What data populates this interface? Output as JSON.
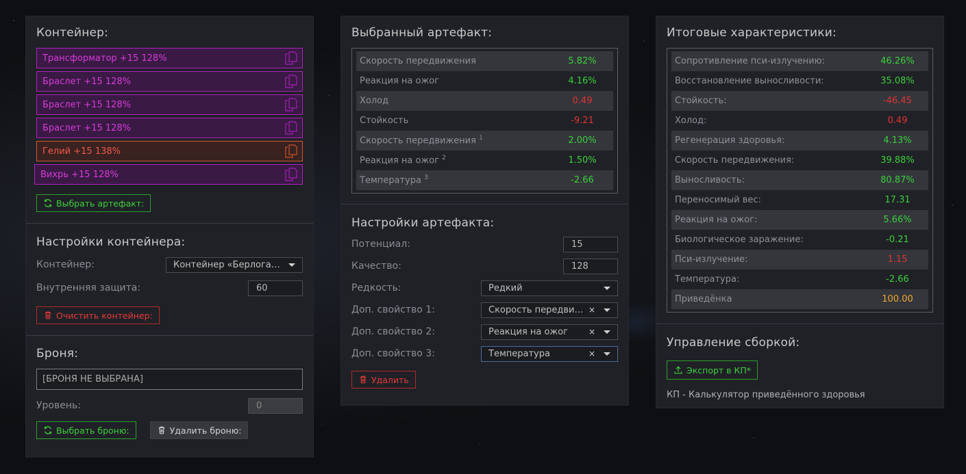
{
  "container": {
    "title": "Контейнер:",
    "items": [
      {
        "label": "Трансформатор +15 128%",
        "color": "purple"
      },
      {
        "label": "Браслет +15 128%",
        "color": "purple"
      },
      {
        "label": "Браслет +15 128%",
        "color": "purple"
      },
      {
        "label": "Браслет +15 128%",
        "color": "purple"
      },
      {
        "label": "Гелий +15 138%",
        "color": "orange"
      },
      {
        "label": "Вихрь +15 128%",
        "color": "purple"
      }
    ],
    "select_artifact_label": "Выбрать артефакт:"
  },
  "container_settings": {
    "title": "Настройки контейнера:",
    "container_label": "Контейнер:",
    "container_value": "Контейнер «Берлога…",
    "inner_protection_label": "Внутренняя защита:",
    "inner_protection_value": "60",
    "clear_label": "Очистить контейнер:"
  },
  "armor": {
    "title": "Броня:",
    "value": "[БРОНЯ НЕ ВЫБРАНА]",
    "level_label": "Уровень:",
    "level_value": "0",
    "select_label": "Выбрать броню:",
    "delete_label": "Удалить броню:"
  },
  "selected_artifact": {
    "title": "Выбранный артефакт:",
    "stats": [
      {
        "name": "Скорость передвижения",
        "sup": "",
        "value": "5.82%",
        "tone": "green"
      },
      {
        "name": "Реакция на ожог",
        "sup": "",
        "value": "4.16%",
        "tone": "green"
      },
      {
        "name": "Холод",
        "sup": "",
        "value": "0.49",
        "tone": "red"
      },
      {
        "name": "Стойкость",
        "sup": "",
        "value": "-9.21",
        "tone": "red"
      },
      {
        "name": "Скорость передвижения",
        "sup": "1",
        "value": "2.00%",
        "tone": "green"
      },
      {
        "name": "Реакция на ожог",
        "sup": "2",
        "value": "1.50%",
        "tone": "green"
      },
      {
        "name": "Температура",
        "sup": "3",
        "value": "-2.66",
        "tone": "green"
      }
    ]
  },
  "artifact_settings": {
    "title": "Настройки артефакта:",
    "potential_label": "Потенциал:",
    "potential_value": "15",
    "quality_label": "Качество:",
    "quality_value": "128",
    "rarity_label": "Редкость:",
    "rarity_value": "Редкий",
    "extra1_label": "Доп. свойство 1:",
    "extra1_value": "Скорость передвижения",
    "extra2_label": "Доп. свойство 2:",
    "extra2_value": "Реакция на ожог",
    "extra3_label": "Доп. свойство 3:",
    "extra3_value": "Температура",
    "clear_symbol": "×",
    "delete_label": "Удалить"
  },
  "totals": {
    "title": "Итоговые характеристики:",
    "stats": [
      {
        "name": "Сопротивление пси-излучению:",
        "value": "46.26%",
        "tone": "green"
      },
      {
        "name": "Восстановление выносливости:",
        "value": "35.08%",
        "tone": "green"
      },
      {
        "name": "Стойкость:",
        "value": "-46.45",
        "tone": "red"
      },
      {
        "name": "Холод:",
        "value": "0.49",
        "tone": "red"
      },
      {
        "name": "Регенерация здоровья:",
        "value": "4.13%",
        "tone": "green"
      },
      {
        "name": "Скорость передвижения:",
        "value": "39.88%",
        "tone": "green"
      },
      {
        "name": "Выносливость:",
        "value": "80.87%",
        "tone": "green"
      },
      {
        "name": "Переносимый вес:",
        "value": "17.31",
        "tone": "green"
      },
      {
        "name": "Реакция на ожог:",
        "value": "5.66%",
        "tone": "green"
      },
      {
        "name": "Биологическое заражение:",
        "value": "-0.21",
        "tone": "green"
      },
      {
        "name": "Пси-излучение:",
        "value": "1.15",
        "tone": "red"
      },
      {
        "name": "Температура:",
        "value": "-2.66",
        "tone": "green"
      },
      {
        "name": "Приведёнка",
        "value": "100.00",
        "tone": "orange"
      }
    ]
  },
  "build": {
    "title": "Управление сборкой:",
    "export_label": "Экспорт в КП*",
    "note": "КП - Калькулятор приведённого здоровья"
  },
  "colors": {
    "purple_border": "#b01ec0",
    "orange_border": "#d4582e",
    "green": "#3ccf3c",
    "red": "#e03434",
    "gold": "#f0a830"
  }
}
